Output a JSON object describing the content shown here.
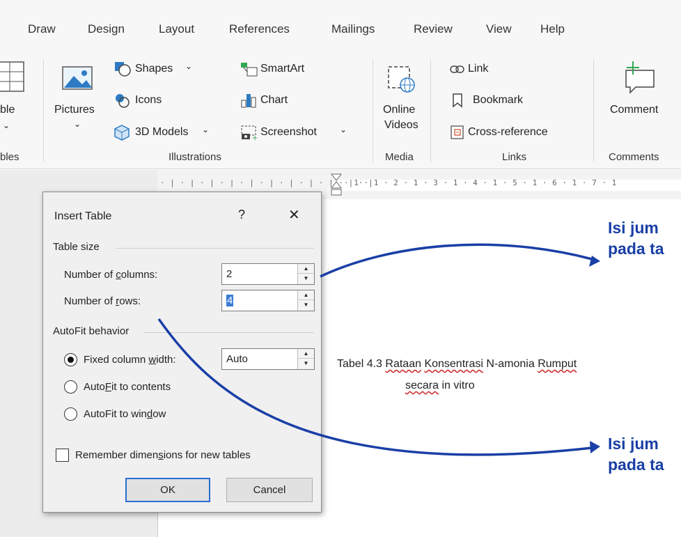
{
  "menu": {
    "tabs": [
      "Draw",
      "Design",
      "Layout",
      "References",
      "Mailings",
      "Review",
      "View",
      "Help"
    ]
  },
  "ribbon": {
    "tables": {
      "label_partial": "ble",
      "group_partial": "bles"
    },
    "illustrations": {
      "pictures": "Pictures",
      "shapes": "Shapes",
      "icons": "Icons",
      "models": "3D Models",
      "smartart": "SmartArt",
      "chart": "Chart",
      "screenshot": "Screenshot",
      "group": "Illustrations"
    },
    "media": {
      "online": "Online",
      "videos": "Videos",
      "group": "Media"
    },
    "links": {
      "link": "Link",
      "bookmark": "Bookmark",
      "crossref": "Cross-reference",
      "group": "Links"
    },
    "comments": {
      "comment": "Comment",
      "group": "Comments"
    }
  },
  "ruler": {
    "marks": "· 1 · 1 · 2 · 1 · 3 · 1 · 4 · 1 · 5 · 1 · 6 · 1 · 7 · 1"
  },
  "document": {
    "caption_prefix": "Tabel 4.3 ",
    "caption_w1": "Rataan",
    "caption_w2": "Konsentrasi",
    "caption_w3": "N-amonia",
    "caption_w4": "Rumput",
    "caption_line2_w1": "secara",
    "caption_line2_rest": " in vitro"
  },
  "notes": {
    "top_line1": "Isi jum",
    "top_line2": "pada ta",
    "bottom_line1": "Isi jum",
    "bottom_line2": "pada ta"
  },
  "dialog": {
    "title": "Insert Table",
    "help": "?",
    "close": "✕",
    "table_size": "Table size",
    "columns_label_pre": "Number of ",
    "columns_label_u": "c",
    "columns_label_post": "olumns:",
    "columns_value": "2",
    "rows_label_pre": "Number of ",
    "rows_label_u": "r",
    "rows_label_post": "ows:",
    "rows_value": "4",
    "autofit": "AutoFit behavior",
    "fixed_pre": "Fixed column ",
    "fixed_u": "w",
    "fixed_post": "idth:",
    "fixed_value": "Auto",
    "contents_pre": "Auto",
    "contents_u": "F",
    "contents_post": "it to contents",
    "window_pre": "AutoFit to win",
    "window_u": "d",
    "window_post": "ow",
    "remember_pre": "Remember dimen",
    "remember_u": "s",
    "remember_post": "ions for new tables",
    "ok": "OK",
    "cancel": "Cancel"
  }
}
